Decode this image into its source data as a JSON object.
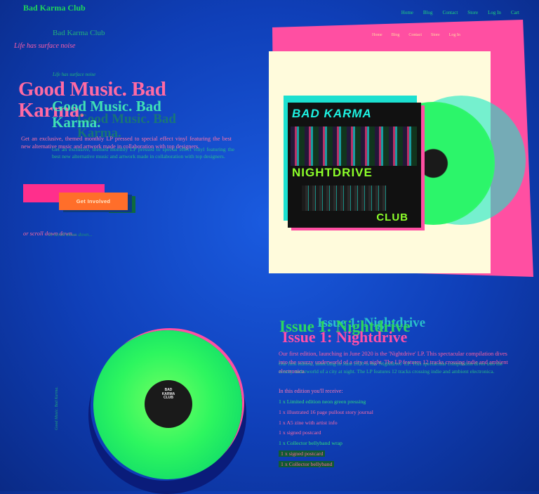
{
  "header": {
    "brand": "Bad Karma Club",
    "nav": [
      "Home",
      "Blog",
      "Contact",
      "Store",
      "Log In",
      "Cart"
    ]
  },
  "hero": {
    "tagline": "Life has surface noise",
    "headline": "Good Music. Bad Karma.",
    "description": "Get an exclusive, themed monthly LP pressed to special effect vinyl featuring the best new alternative music and artwork made in collaboration with top designers.",
    "cta_label": "Get Involved",
    "scroll_hint": "or scroll down down..."
  },
  "album_art": {
    "top": "BAD KARMA",
    "middle": "NIGHTDRIVE",
    "bottom": "CLUB"
  },
  "record_label": [
    "BAD",
    "KARMA",
    "CLUB"
  ],
  "vertical_text": "Good Music. Bad Karma.",
  "issue": {
    "title": "Issue 1: Nightdrive",
    "description": "Our first edition, launching in June 2020 is the 'Nightdrive' LP. This spectacular compilation dives into the scuzzy underworld of a city at night. The LP features 12 tracks crossing indie and ambient electronica.",
    "receive_label": "In this edition you'll receive:",
    "items": [
      "1 x Limited edition neon green pressing",
      "1 x illustrated 16 page pullout story journal",
      "1 x A5 zine with artist info",
      "1 x signed postcard",
      "1 x Collector bellyband wrap",
      "1 x signed postcard",
      "1 x Collector bellyband"
    ]
  },
  "colors": {
    "background": "#0f3fb8",
    "pink": "#ff4fa2",
    "green": "#2df65f",
    "cyan": "#34f3cf",
    "cta": "#ff6e2a"
  }
}
